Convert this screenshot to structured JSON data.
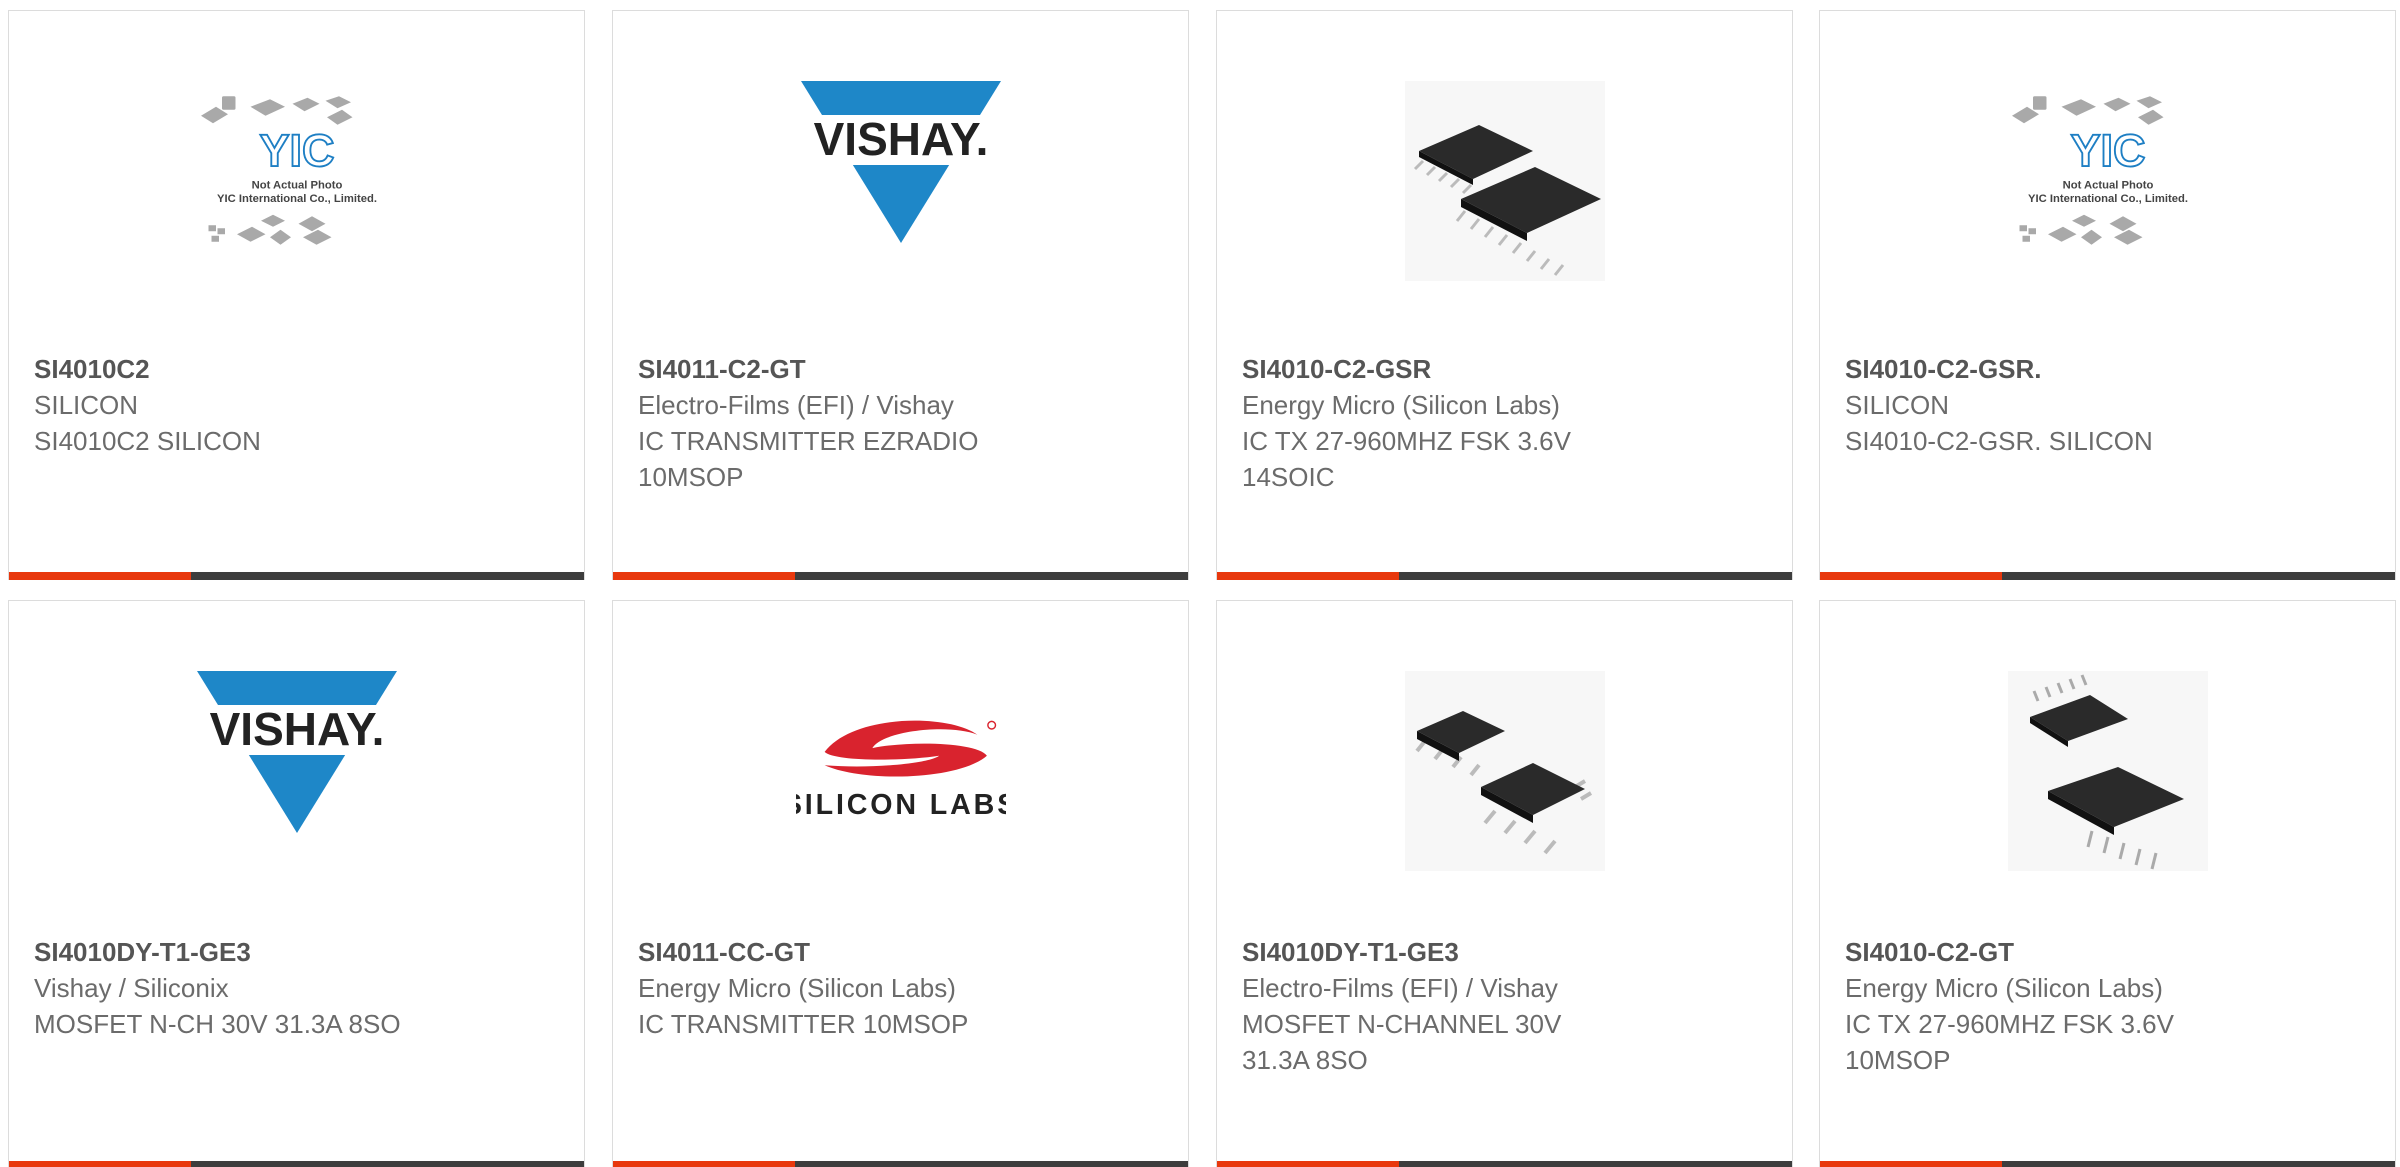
{
  "colors": {
    "accent": "#e8380d",
    "bar": "#3d3d3d",
    "vishay_blue": "#1e87c8",
    "silabs_red": "#d9232e"
  },
  "products": [
    {
      "part": "SI4010C2",
      "maker": "SILICON",
      "desc": "SI4010C2 SILICON",
      "desc2": "",
      "image": "yic-placeholder",
      "placeholder_line1": "Not Actual Photo",
      "placeholder_line2": "YIC International Co., Limited.",
      "logo_text": "YIC"
    },
    {
      "part": "SI4011-C2-GT",
      "maker": "Electro-Films (EFI) / Vishay",
      "desc": "IC TRANSMITTER EZRADIO",
      "desc2": "10MSOP",
      "image": "vishay-logo",
      "logo_text": "VISHAY."
    },
    {
      "part": "SI4010-C2-GSR",
      "maker": "Energy Micro (Silicon Labs)",
      "desc": "IC TX 27-960MHZ FSK 3.6V",
      "desc2": "14SOIC",
      "image": "soic-chips"
    },
    {
      "part": "SI4010-C2-GSR.",
      "maker": "SILICON",
      "desc": "SI4010-C2-GSR. SILICON",
      "desc2": "",
      "image": "yic-placeholder",
      "placeholder_line1": "Not Actual Photo",
      "placeholder_line2": "YIC International Co., Limited.",
      "logo_text": "YIC"
    },
    {
      "part": "SI4010DY-T1-GE3",
      "maker": "Vishay / Siliconix",
      "desc": "MOSFET N-CH 30V 31.3A 8SO",
      "desc2": "",
      "image": "vishay-logo",
      "logo_text": "VISHAY."
    },
    {
      "part": "SI4011-CC-GT",
      "maker": "Energy Micro (Silicon Labs)",
      "desc": "IC TRANSMITTER 10MSOP",
      "desc2": "",
      "image": "silicon-labs-logo",
      "logo_text": "SILICON LABS"
    },
    {
      "part": "SI4010DY-T1-GE3",
      "maker": "Electro-Films (EFI) / Vishay",
      "desc": "MOSFET N-CHANNEL 30V",
      "desc2": "31.3A 8SO",
      "image": "so8-chips"
    },
    {
      "part": "SI4010-C2-GT",
      "maker": "Energy Micro (Silicon Labs)",
      "desc": "IC TX 27-960MHZ FSK 3.6V",
      "desc2": "10MSOP",
      "image": "msop-chips"
    }
  ]
}
